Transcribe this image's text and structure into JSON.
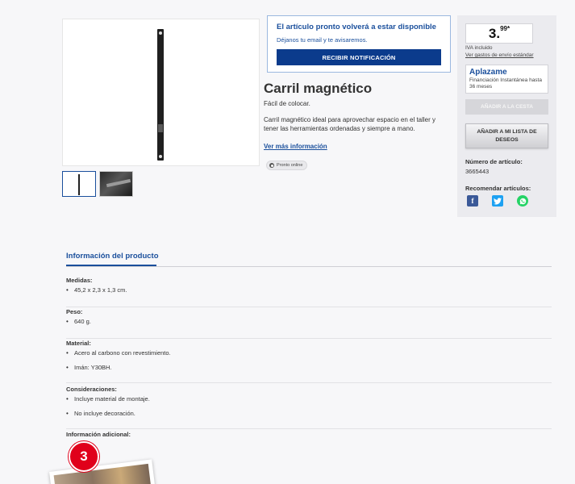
{
  "product": {
    "title": "Carril magnético",
    "subtitle": "Fácil de colocar.",
    "description": "Carril magnético ideal para aprovechar espacio en el taller y tener las herramientas ordenadas y siempre a mano.",
    "more_link": "Ver más información",
    "availability_pill": "Pronto online"
  },
  "notify": {
    "title": "El artículo pronto volverá a estar disponible",
    "subtitle": "Déjanos tu email y te avisaremos.",
    "button": "RECIBIR NOTIFICACIÓN"
  },
  "buybox": {
    "price_int": "3.",
    "price_dec": "99*",
    "iva": "IVA incluido",
    "shipping_link": "Ver gastos de envío estándar",
    "aplazame_logo": "Aplazame",
    "aplazame_info": "Financiación Instantánea hasta 36 meses",
    "cart_button": "AÑADIR A LA CESTA",
    "wishlist_button": "AÑADIR A MI LISTA DE DESEOS",
    "article_label": "Número de artículo:",
    "article_number": "3665443",
    "recommend_label": "Recomendar artículos:"
  },
  "info": {
    "tab": "Información del producto",
    "sections": [
      {
        "title": "Medidas:",
        "items": [
          "45,2 x 2,3 x 1,3 cm."
        ]
      },
      {
        "title": "Peso:",
        "items": [
          "640 g."
        ]
      },
      {
        "title": "Material:",
        "items": [
          "Acero al carbono con revestimiento.",
          "Imán: Y30BH."
        ]
      },
      {
        "title": "Consideraciones:",
        "items": [
          "Incluye material de montaje.",
          "No incluye decoración."
        ]
      },
      {
        "title": "Información adicional:",
        "items": []
      }
    ]
  },
  "badge": {
    "number": "3"
  },
  "colors": {
    "accent": "#1a4f9c",
    "button_dark": "#0b3b8c",
    "badge": "#e0001b"
  }
}
